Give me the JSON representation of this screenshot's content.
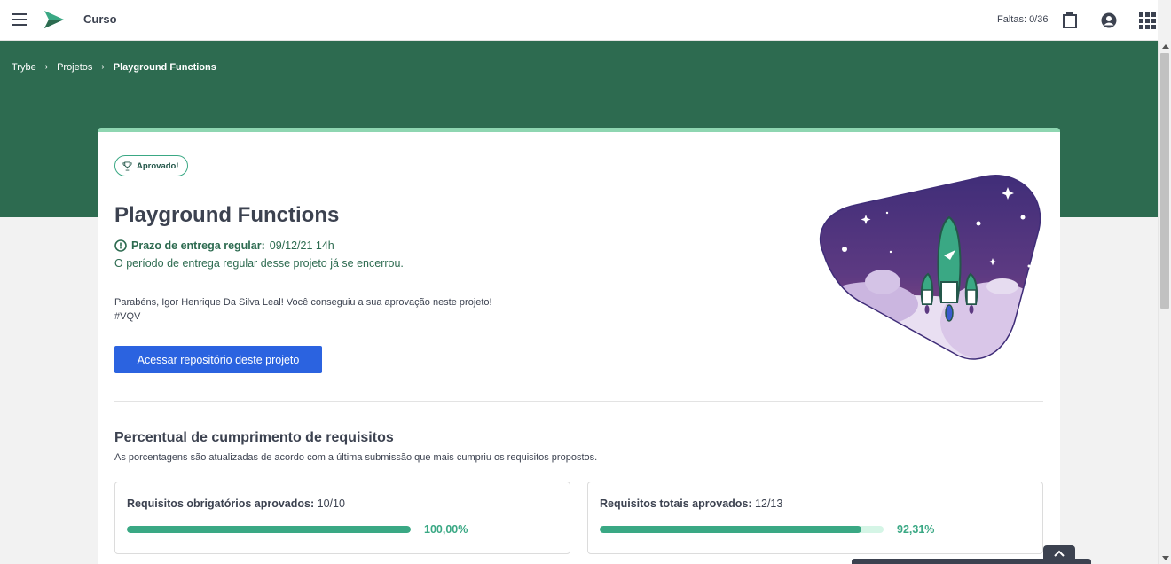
{
  "header": {
    "title": "Curso",
    "faltas": "Faltas: 0/36",
    "icons": [
      "menu-icon",
      "trybe-logo",
      "briefcase-icon",
      "account-icon",
      "apps-grid-icon"
    ]
  },
  "breadcrumb": {
    "items": [
      "Trybe",
      "Projetos"
    ],
    "current": "Playground Functions",
    "separator": "›"
  },
  "project": {
    "badge": "Aprovado!",
    "title": "Playground Functions",
    "deadline_label": "Prazo de entrega regular:",
    "deadline_value": "09/12/21 14h",
    "deadline_note": "O período de entrega regular desse projeto já se encerrou.",
    "congrats": "Parabéns, Igor Henrique Da Silva Leal! Você conseguiu a sua aprovação neste projeto!",
    "hashtag": "#VQV",
    "repo_button": "Acessar repositório deste projeto"
  },
  "requirements": {
    "title": "Percentual de cumprimento de requisitos",
    "subtitle": "As porcentagens são atualizadas de acordo com a última submissão que mais cumpriu os requisitos propostos.",
    "mandatory": {
      "label": "Requisitos obrigatórios aprovados:",
      "value": "10/10",
      "percent_text": "100,00%",
      "fraction": 1.0
    },
    "total": {
      "label": "Requisitos totais aprovados:",
      "value": "12/13",
      "percent_text": "92,31%",
      "fraction": 0.9231
    }
  },
  "colors": {
    "brand_green": "#2d6b50",
    "accent_green": "#3aa884",
    "button_blue": "#2b63e0",
    "text_dark": "#3c4250"
  }
}
